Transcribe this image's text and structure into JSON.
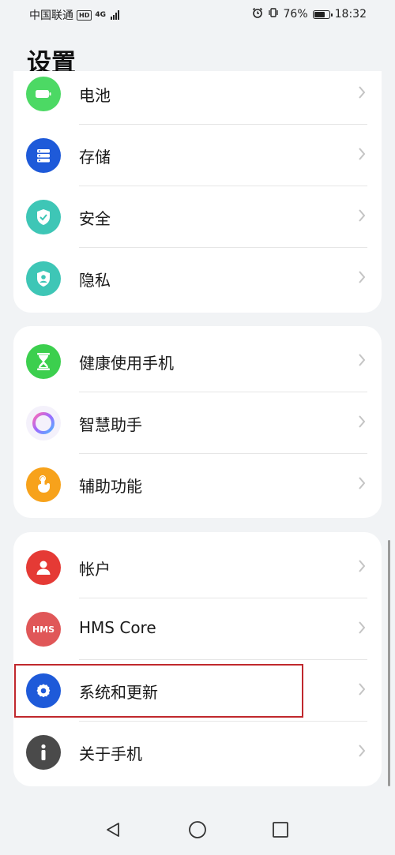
{
  "status_bar": {
    "carrier": "中国联通",
    "hd_badge": "HD",
    "network": "4G",
    "battery_percent": "76%",
    "time": "18:32",
    "battery_level": 0.76
  },
  "page": {
    "title": "设置"
  },
  "groups": [
    {
      "items": [
        {
          "label": "电池",
          "icon": "battery-icon",
          "color": "#4cd964"
        },
        {
          "label": "存储",
          "icon": "storage-icon",
          "color": "#1e5ad9"
        },
        {
          "label": "安全",
          "icon": "shield-icon",
          "color": "#3ec6b6"
        },
        {
          "label": "隐私",
          "icon": "privacy-icon",
          "color": "#3ec6b6"
        }
      ]
    },
    {
      "items": [
        {
          "label": "健康使用手机",
          "icon": "hourglass-icon",
          "color": "#3ccf4e"
        },
        {
          "label": "智慧助手",
          "icon": "assistant-ring-icon",
          "color": "#b86bff"
        },
        {
          "label": "辅助功能",
          "icon": "hand-icon",
          "color": "#f7a21b"
        }
      ]
    },
    {
      "items": [
        {
          "label": "帐户",
          "icon": "account-icon",
          "color": "#e53a35"
        },
        {
          "label": "HMS Core",
          "icon": "hms-icon",
          "color": "#e05758",
          "icon_text": "HMS"
        },
        {
          "label": "系统和更新",
          "icon": "gear-icon",
          "color": "#1e5ad9"
        },
        {
          "label": "关于手机",
          "icon": "info-icon",
          "color": "#4a4a4a"
        }
      ]
    }
  ]
}
